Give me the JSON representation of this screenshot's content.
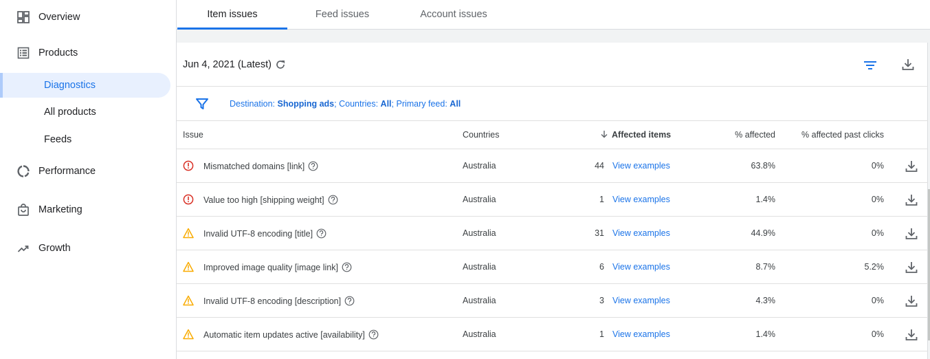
{
  "sidebar": {
    "overview": "Overview",
    "products": "Products",
    "diagnostics": "Diagnostics",
    "all_products": "All products",
    "feeds": "Feeds",
    "performance": "Performance",
    "marketing": "Marketing",
    "growth": "Growth"
  },
  "tabs": {
    "item_issues": "Item issues",
    "feed_issues": "Feed issues",
    "account_issues": "Account issues"
  },
  "toolbar": {
    "date": "Jun 4, 2021 (Latest)"
  },
  "filter": {
    "destination_label": "Destination:",
    "destination_value": "Shopping ads",
    "countries_label": "; Countries:",
    "countries_value": "All",
    "feed_label": "; Primary feed:",
    "feed_value": "All"
  },
  "table": {
    "headers": {
      "issue": "Issue",
      "countries": "Countries",
      "affected_items": "Affected items",
      "pct_affected": "% affected",
      "pct_past_clicks": "% affected past clicks"
    },
    "rows": [
      {
        "status": "error",
        "issue": "Mismatched domains [link]",
        "country": "Australia",
        "affected": "44",
        "link": "View examples",
        "pct": "63.8%",
        "clicks": "0%"
      },
      {
        "status": "error",
        "issue": "Value too high [shipping weight]",
        "country": "Australia",
        "affected": "1",
        "link": "View examples",
        "pct": "1.4%",
        "clicks": "0%"
      },
      {
        "status": "warning",
        "issue": "Invalid UTF-8 encoding [title]",
        "country": "Australia",
        "affected": "31",
        "link": "View examples",
        "pct": "44.9%",
        "clicks": "0%"
      },
      {
        "status": "warning",
        "issue": "Improved image quality [image link]",
        "country": "Australia",
        "affected": "6",
        "link": "View examples",
        "pct": "8.7%",
        "clicks": "5.2%"
      },
      {
        "status": "warning",
        "issue": "Invalid UTF-8 encoding [description]",
        "country": "Australia",
        "affected": "3",
        "link": "View examples",
        "pct": "4.3%",
        "clicks": "0%"
      },
      {
        "status": "warning",
        "issue": "Automatic item updates active [availability]",
        "country": "Australia",
        "affected": "1",
        "link": "View examples",
        "pct": "1.4%",
        "clicks": "0%"
      }
    ]
  },
  "colors": {
    "accent": "#1a73e8",
    "error": "#d93025",
    "warning": "#f9ab00"
  }
}
